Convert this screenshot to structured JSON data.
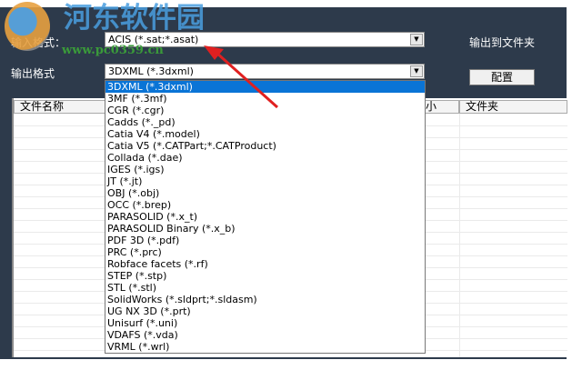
{
  "watermark": {
    "site_name": "河东软件园",
    "url": "www.pc0359.cn"
  },
  "input_format": {
    "label": "输入格式：",
    "value": "ACIS (*.sat;*.asat)"
  },
  "output_format": {
    "label": "输出格式",
    "value": "3DXML (*.3dxml)"
  },
  "output_folder_label": "输出到文件夹",
  "config_button": "配置",
  "table": {
    "columns": [
      "文件名称",
      "小",
      "文件夹"
    ]
  },
  "dropdown": {
    "selected_index": 0,
    "options": [
      "3DXML (*.3dxml)",
      "3MF (*.3mf)",
      "CGR (*.cgr)",
      "Cadds (*._pd)",
      "Catia V4 (*.model)",
      "Catia V5 (*.CATPart;*.CATProduct)",
      "Collada (*.dae)",
      "IGES (*.igs)",
      "JT (*.jt)",
      "OBJ (*.obj)",
      "OCC (*.brep)",
      "PARASOLID (*.x_t)",
      "PARASOLID Binary (*.x_b)",
      "PDF 3D (*.pdf)",
      "PRC (*.prc)",
      "Robface facets (*.rf)",
      "STEP (*.stp)",
      "STL (*.stl)",
      "SolidWorks (*.sldprt;*.sldasm)",
      "UG NX 3D (*.prt)",
      "Unisurf (*.uni)",
      "VDAFS (*.vda)",
      "VRML (*.wrl)"
    ]
  },
  "colors": {
    "window_bg": "#2d3a4b",
    "selection": "#0a74d6",
    "arrow": "#e02020"
  }
}
